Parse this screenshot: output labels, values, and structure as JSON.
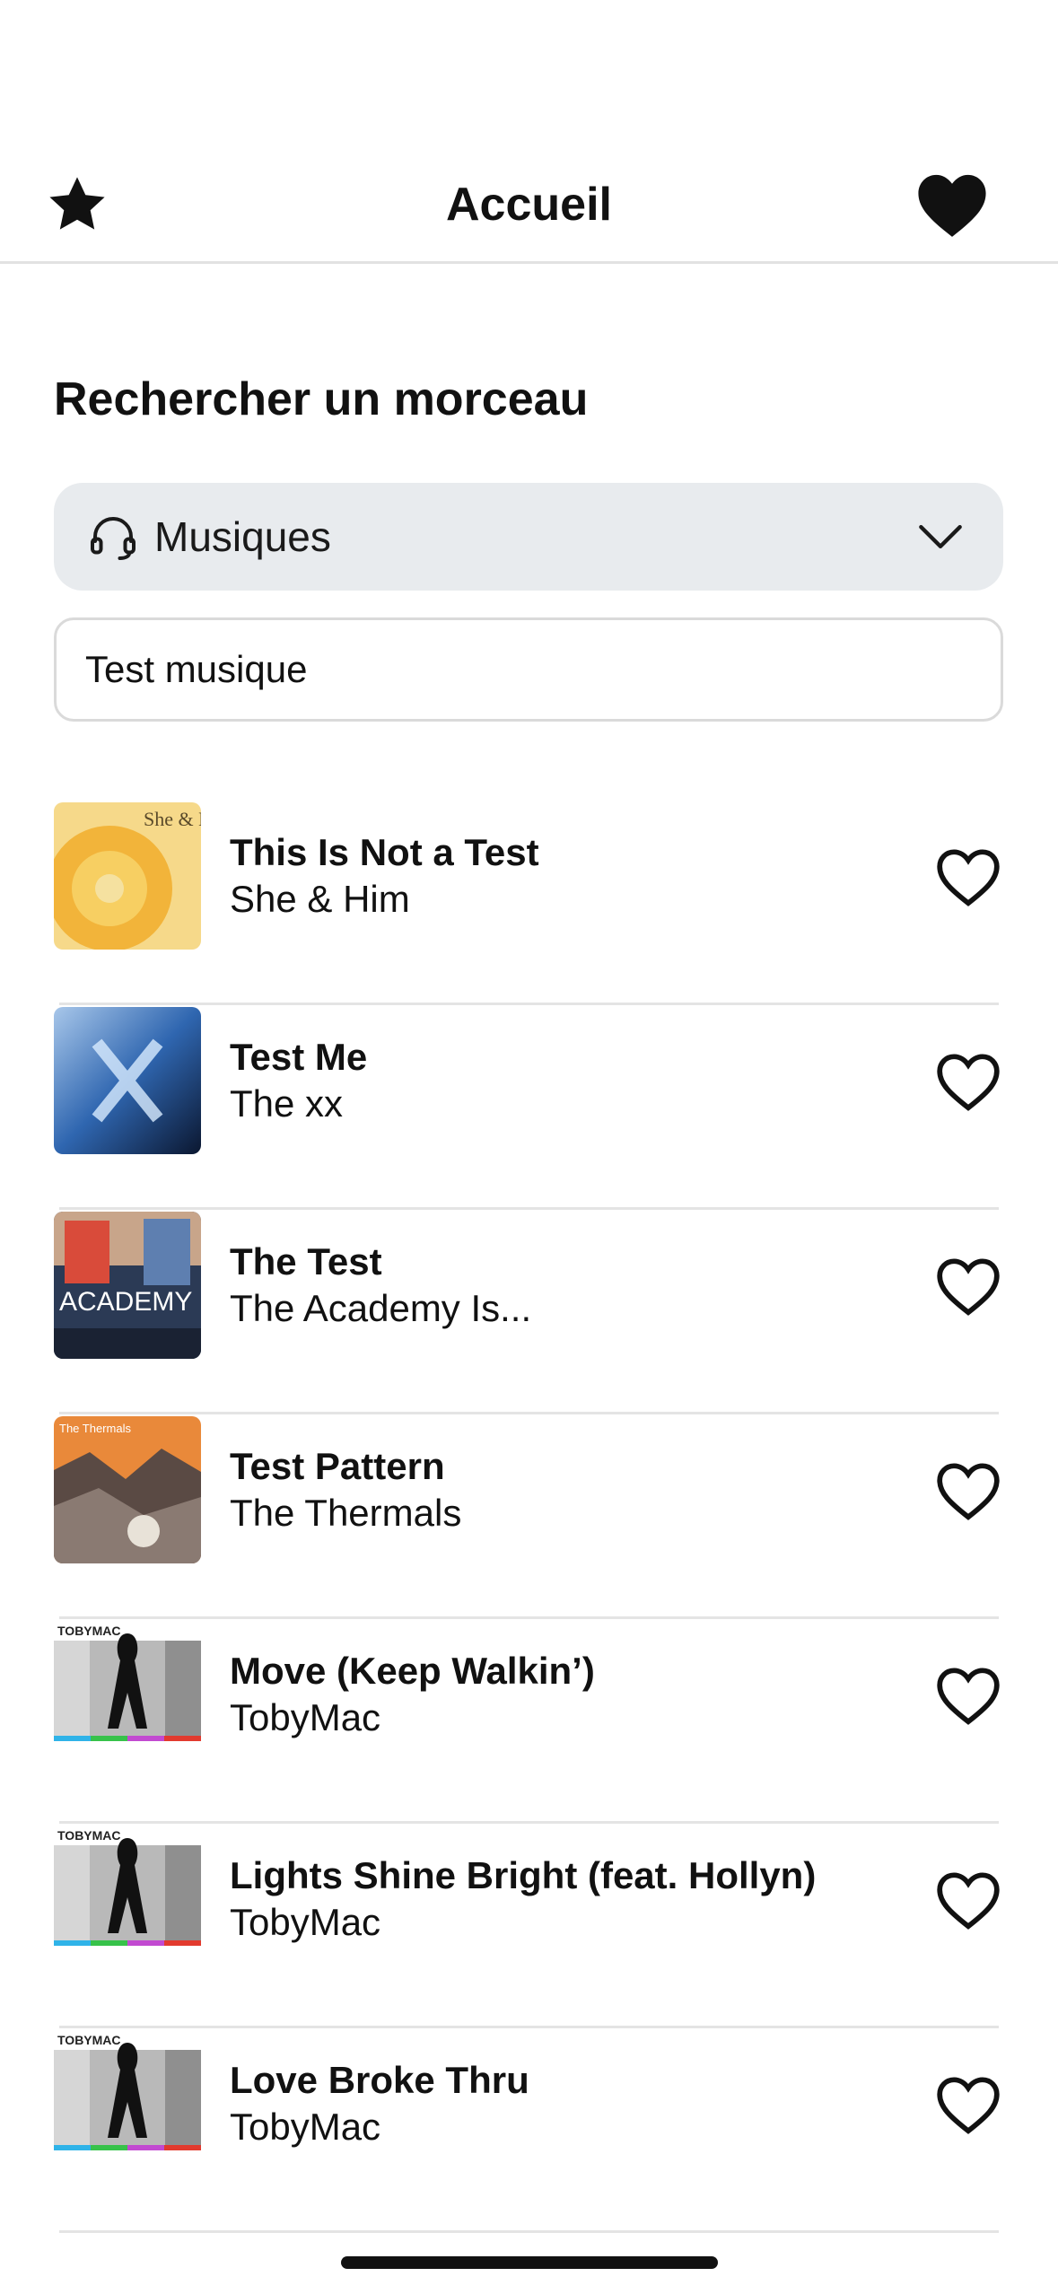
{
  "nav": {
    "title": "Accueil",
    "left_icon": "star-icon",
    "right_icon": "heart-filled-icon"
  },
  "search_section": {
    "title": "Rechercher un morceau",
    "category": {
      "icon": "headphones-icon",
      "selected": "Musiques",
      "chevron_icon": "chevron-down-icon"
    },
    "query": "Test musique"
  },
  "results": [
    {
      "title": "This Is Not a Test",
      "artist": "She & Him",
      "artwork_label": "She & Him"
    },
    {
      "title": "Test Me",
      "artist": "The xx"
    },
    {
      "title": "The Test",
      "artist": "The Academy Is...",
      "artwork_label": "ACADEMY"
    },
    {
      "title": "Test Pattern",
      "artist": "The Thermals",
      "artwork_label": "The Thermals"
    },
    {
      "title": "Move (Keep Walkin’)",
      "artist": "TobyMac",
      "artwork_label": "TOBYMAC"
    },
    {
      "title": "Lights Shine Bright (feat. Hollyn)",
      "artist": "TobyMac",
      "artwork_label": "TOBYMAC"
    },
    {
      "title": "Love Broke Thru",
      "artist": "TobyMac",
      "artwork_label": "TOBYMAC"
    }
  ],
  "favorite_icon": "heart-outline-icon",
  "colors": {
    "background": "#ffffff",
    "dropdown_bg": "#e8ebee",
    "divider": "#e4e4e4",
    "text": "#111111"
  }
}
